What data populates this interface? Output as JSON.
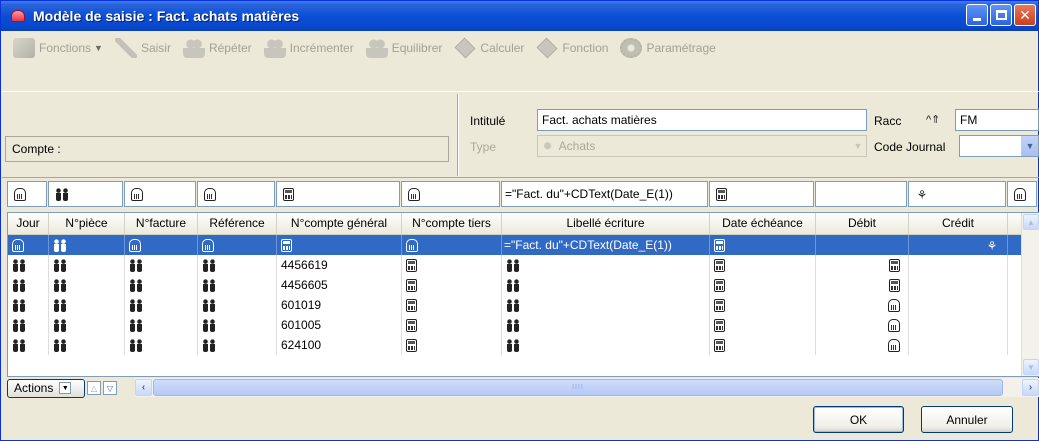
{
  "window": {
    "title": "Modèle de saisie : Fact. achats matières"
  },
  "toolbar": {
    "items": [
      {
        "label": "Fonctions",
        "icon": "functions-icon"
      },
      {
        "label": "Saisir",
        "icon": "pencil-icon"
      },
      {
        "label": "Répéter",
        "icon": "repeat-icon"
      },
      {
        "label": "Incrémenter",
        "icon": "increment-icon"
      },
      {
        "label": "Equilibrer",
        "icon": "balance-icon"
      },
      {
        "label": "Calculer",
        "icon": "calculate-icon"
      },
      {
        "label": "Fonction",
        "icon": "function-icon"
      },
      {
        "label": "Paramétrage",
        "icon": "settings-icon"
      }
    ]
  },
  "header": {
    "compte_label": "Compte :",
    "intitule_label": "Intitulé",
    "intitule_value": "Fact. achats matières",
    "type_label": "Type",
    "type_value": "Achats",
    "racc_label": "Racc",
    "racc_shortcut_icon": "^⇑",
    "racc_value": "FM",
    "code_journal_label": "Code Journal",
    "code_journal_value": ""
  },
  "filter_row": {
    "libelle_formula": "=\"Fact. du\"+CDText(Date_E(1))"
  },
  "grid": {
    "columns": [
      "Jour",
      "N°pièce",
      "N°facture",
      "Référence",
      "N°compte général",
      "N°compte tiers",
      "Libellé écriture",
      "Date échéance",
      "Débit",
      "Crédit"
    ],
    "selected_row": {
      "libelle": "=\"Fact. du\"+CDText(Date_E(1))"
    },
    "rows": [
      {
        "compte_general": "4456619"
      },
      {
        "compte_general": "4456605"
      },
      {
        "compte_general": "601019"
      },
      {
        "compte_general": "601005"
      },
      {
        "compte_general": "624100"
      }
    ]
  },
  "bottom": {
    "actions_label": "Actions",
    "hscroll_grip": "IIII"
  },
  "footer": {
    "ok_label": "OK",
    "cancel_label": "Annuler"
  }
}
